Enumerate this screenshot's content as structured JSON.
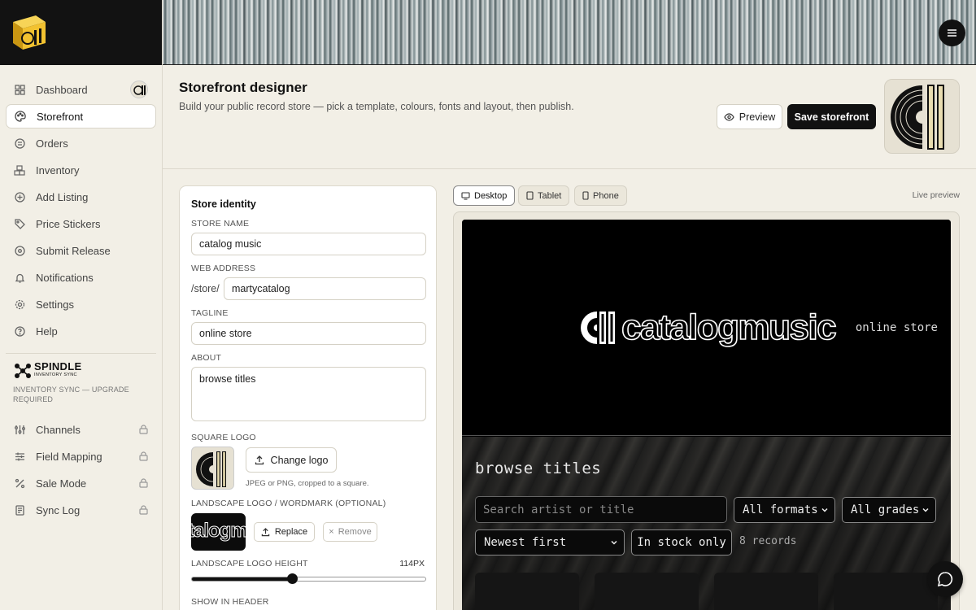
{
  "sidebar": {
    "items": [
      {
        "label": "Dashboard",
        "icon": "grid-icon"
      },
      {
        "label": "Storefront",
        "icon": "palette-icon",
        "active": true
      },
      {
        "label": "Orders",
        "icon": "receipt-icon"
      },
      {
        "label": "Inventory",
        "icon": "boxes-icon"
      },
      {
        "label": "Add Listing",
        "icon": "plus-circle-icon"
      },
      {
        "label": "Price Stickers",
        "icon": "tag-icon"
      },
      {
        "label": "Submit Release",
        "icon": "disc-icon"
      },
      {
        "label": "Notifications",
        "icon": "bell-icon"
      },
      {
        "label": "Settings",
        "icon": "gear-icon"
      },
      {
        "label": "Help",
        "icon": "help-circle-icon"
      }
    ],
    "spindle_note": "INVENTORY SYNC — UPGRADE REQUIRED",
    "spindle_logo_text": "SPINDLE",
    "spindle_logo_subtext": "INVENTORY SYNC",
    "locked_items": [
      {
        "label": "Channels",
        "icon": "channels-icon"
      },
      {
        "label": "Field Mapping",
        "icon": "sliders-icon"
      },
      {
        "label": "Sale Mode",
        "icon": "percent-icon"
      },
      {
        "label": "Sync Log",
        "icon": "log-icon"
      }
    ]
  },
  "header": {
    "title": "Storefront designer",
    "subtitle": "Build your public record store — pick a template, colours, fonts and layout, then publish.",
    "preview_label": "Preview",
    "save_label": "Save storefront"
  },
  "identity": {
    "title": "Store identity",
    "store_name_label": "STORE NAME",
    "store_name": "catalog music",
    "web_address_label": "WEB ADDRESS",
    "web_prefix": "/store/",
    "web_slug": "martycatalog",
    "tagline_label": "TAGLINE",
    "tagline": "online store",
    "about_label": "ABOUT",
    "about": "browse titles",
    "square_logo_label": "SQUARE LOGO",
    "change_logo_label": "Change logo",
    "logo_hint": "JPEG or PNG, cropped to a square.",
    "landscape_label": "LANDSCAPE LOGO / WORDMARK (OPTIONAL)",
    "wordmark_thumb_text": "talogm",
    "replace_label": "Replace",
    "remove_label": "Remove",
    "height_label": "LANDSCAPE LOGO HEIGHT",
    "height_value": "114PX",
    "height_fraction": 0.43,
    "show_header_label": "SHOW IN HEADER"
  },
  "preview": {
    "devices": [
      {
        "label": "Desktop",
        "icon": "monitor-icon",
        "active": true
      },
      {
        "label": "Tablet",
        "icon": "tablet-icon"
      },
      {
        "label": "Phone",
        "icon": "phone-icon"
      }
    ],
    "live_label": "Live preview",
    "wordmark": "catalogmusic",
    "tagline": "online store",
    "browse_title": "browse titles",
    "search_placeholder": "Search artist or title",
    "formats": "All formats",
    "grades": "All grades",
    "sort": "Newest first",
    "in_stock": "In stock only",
    "count": "8 records"
  },
  "colors": {
    "accent": "#111111",
    "logo_yellow": "#f2c230",
    "background": "#f2efe6"
  }
}
